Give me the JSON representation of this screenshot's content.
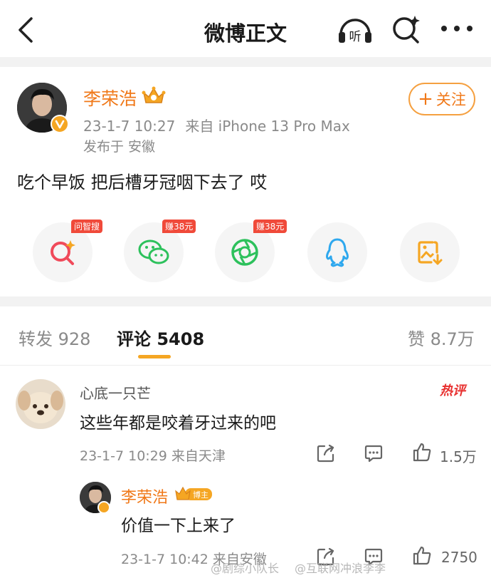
{
  "header": {
    "title": "微博正文",
    "back_icon": "chevron-left-icon",
    "listen_label": "听",
    "search_icon": "ai-search-icon",
    "more_icon": "more-dots-icon"
  },
  "post": {
    "author": "李荣浩",
    "timestamp": "23-1-7 10:27",
    "source": "来自 iPhone 13 Pro Max",
    "location": "发布于 安徽",
    "follow_label": "关注",
    "text": "吃个早饭 把后槽牙冠咽下去了 哎",
    "share_targets": [
      {
        "name": "问智搜",
        "tag": "问智搜",
        "icon": "ai-search-icon",
        "color": "#f04a5a"
      },
      {
        "name": "微信",
        "tag": "赚38元",
        "icon": "wechat-icon",
        "color": "#2dc15c"
      },
      {
        "name": "朋友圈",
        "tag": "赚38元",
        "icon": "moments-icon",
        "color": "#2dc15c"
      },
      {
        "name": "QQ",
        "tag": "",
        "icon": "qq-icon",
        "color": "#2ea8ee"
      },
      {
        "name": "保存图片",
        "tag": "",
        "icon": "save-image-icon",
        "color": "#f5a623"
      }
    ]
  },
  "tabs": {
    "repost": "转发 928",
    "comments": "评论 5408",
    "likes": "赞 8.7万"
  },
  "comments": [
    {
      "user": "心底一只芒",
      "badge": "热评",
      "text": "这些年都是咬着牙过来的吧",
      "meta": "23-1-7 10:29  来自天津",
      "likes": "1.5万"
    }
  ],
  "reply": {
    "user": "李荣浩",
    "badge": "博主",
    "text": "价值一下上来了",
    "meta": "23-1-7 10:42  来自安徽",
    "likes": "2750"
  },
  "watermark": {
    "left": "@剧综小队长",
    "right": "@互联网冲浪李李"
  },
  "colors": {
    "accent": "#f5a623",
    "author": "#f07818",
    "hot": "#e8302f"
  }
}
